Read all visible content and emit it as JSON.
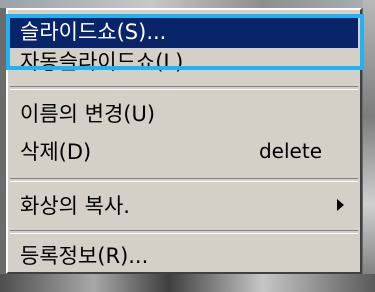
{
  "menu": {
    "items": [
      {
        "label": "슬라이드쇼(S)...",
        "shortcut": "",
        "selected": true
      },
      {
        "label": "자동슬라이드쇼(L)",
        "shortcut": ""
      },
      {
        "label": "이름의 변경(U)",
        "shortcut": ""
      },
      {
        "label": "삭제(D)",
        "shortcut": "delete"
      },
      {
        "label": "화상의 복사.",
        "shortcut": "",
        "submenu": true
      },
      {
        "label": "등록정보(R)...",
        "shortcut": ""
      }
    ]
  },
  "colors": {
    "selection": "#0a246a",
    "menu_bg": "#d4d0c8",
    "highlight_box": "#1fb3f5"
  }
}
